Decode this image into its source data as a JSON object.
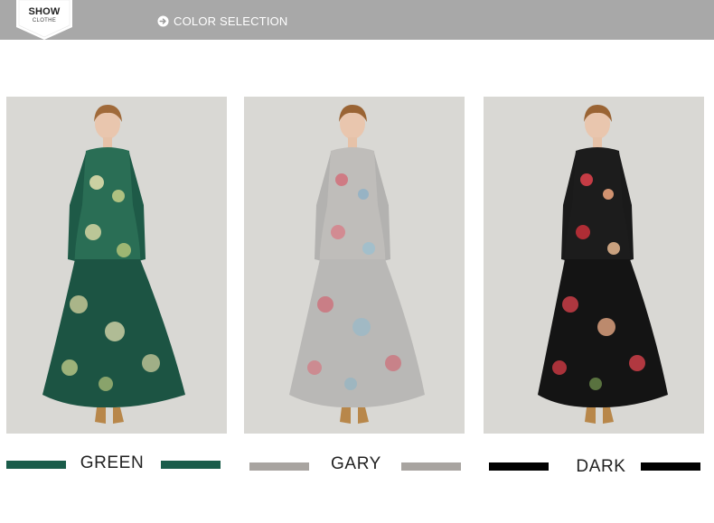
{
  "header": {
    "show_title": "SHOW",
    "show_subtitle": "CLOTHE",
    "section_title": "COLOR SELECTION",
    "icon": "arrow-circle-right-icon",
    "bar_color": "#a8a8a8"
  },
  "products": [
    {
      "label": "GREEN",
      "swatch_color": "#1a5c4a",
      "image": "green-floral-dress-photo"
    },
    {
      "label": "GARY",
      "swatch_color": "#a8a4a0",
      "image": "gray-floral-dress-photo"
    },
    {
      "label": "DARK",
      "swatch_color": "#000000",
      "image": "dark-floral-dress-photo"
    }
  ]
}
